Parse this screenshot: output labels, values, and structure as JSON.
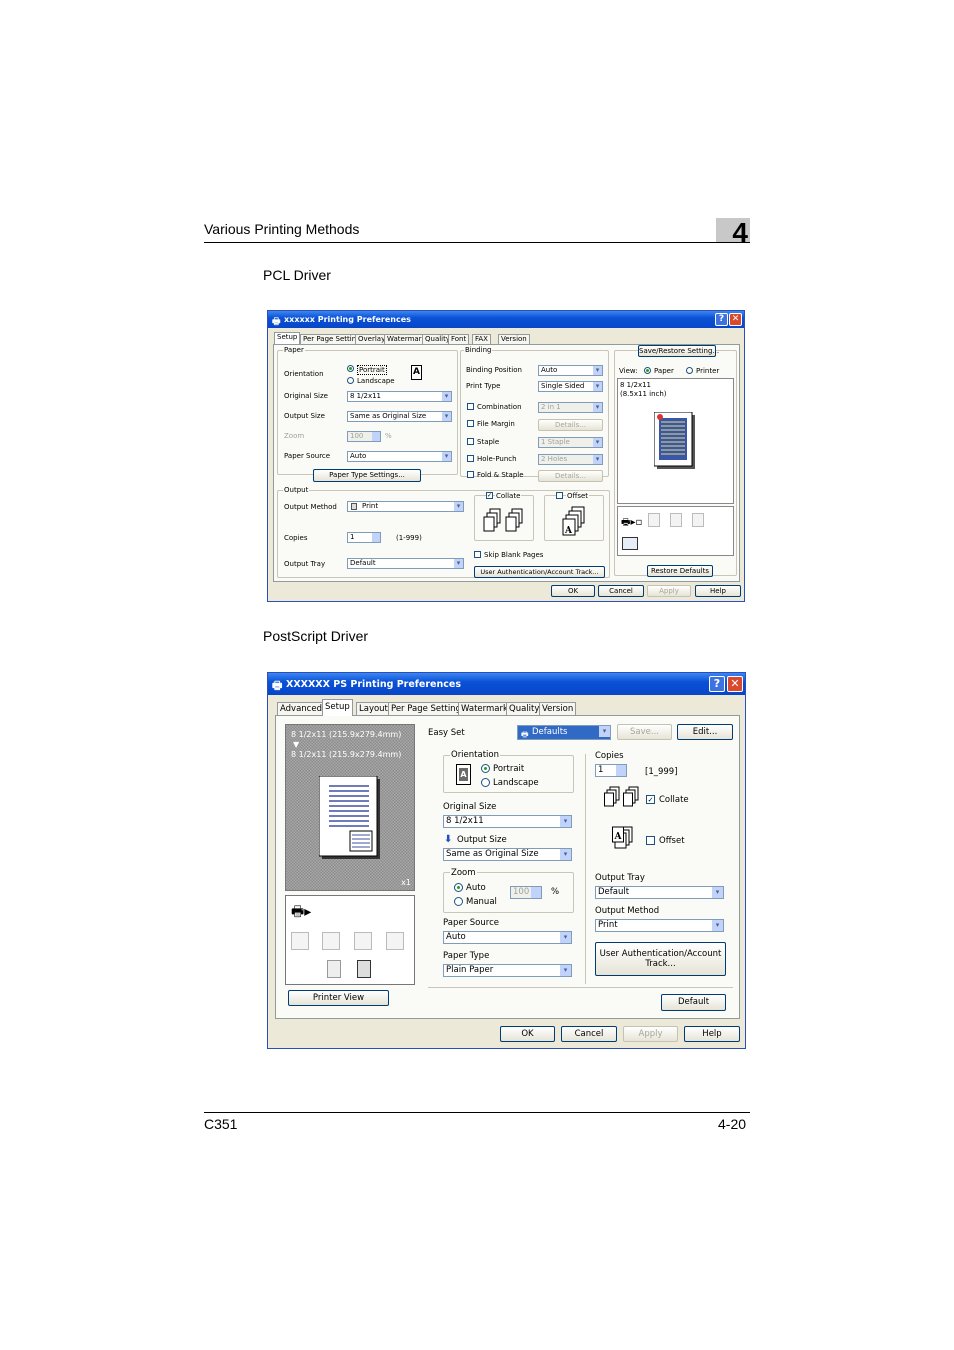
{
  "header": {
    "title": "Various Printing Methods",
    "chapter": "4"
  },
  "sections": {
    "pcl": "PCL Driver",
    "ps": "PostScript Driver"
  },
  "footer": {
    "model": "C351",
    "page": "4-20"
  },
  "pcl": {
    "title": "xxxxxx Printing Preferences",
    "tabs": [
      "Setup",
      "Per Page Setting",
      "Overlay",
      "Watermark",
      "Quality",
      "Font",
      "FAX",
      "Version"
    ],
    "paper": {
      "group": "Paper",
      "orientation_label": "Orientation",
      "portrait": "Portrait",
      "landscape": "Landscape",
      "original_size_label": "Original Size",
      "original_size": "8 1/2x11",
      "output_size_label": "Output Size",
      "output_size": "Same as Original Size",
      "zoom_label": "Zoom",
      "zoom": "100",
      "zoom_unit": "%",
      "paper_source_label": "Paper Source",
      "paper_source": "Auto",
      "paper_type_button": "Paper Type Settings..."
    },
    "binding": {
      "group": "Binding",
      "position_label": "Binding Position",
      "position": "Auto",
      "print_type_label": "Print Type",
      "print_type": "Single Sided",
      "combination": "Combination",
      "combination_value": "2 in 1",
      "details": "Details...",
      "file_margin": "File Margin",
      "staple": "Staple",
      "staple_value": "1 Staple",
      "hole_punch": "Hole-Punch",
      "hole_value": "2 Holes",
      "fold_staple": "Fold & Staple"
    },
    "right": {
      "save_restore": "Save/Restore Setting...",
      "view_label": "View:",
      "view_paper": "Paper",
      "view_printer": "Printer",
      "paper_info_1": "8 1/2x11",
      "paper_info_2": "(8.5x11 inch)",
      "restore_defaults": "Restore Defaults"
    },
    "output": {
      "group": "Output",
      "method_label": "Output Method",
      "method": "Print",
      "copies_label": "Copies",
      "copies": "1",
      "copies_range": "(1-999)",
      "tray_label": "Output Tray",
      "tray": "Default",
      "collate": "Collate",
      "offset": "Offset",
      "skip_blank": "Skip Blank Pages",
      "user_auth": "User Authentication/Account Track..."
    },
    "buttons": {
      "ok": "OK",
      "cancel": "Cancel",
      "apply": "Apply",
      "help": "Help"
    }
  },
  "ps": {
    "title": "XXXXXX PS Printing Preferences",
    "tabs": [
      "Advanced",
      "Setup",
      "Layout",
      "Per Page Setting",
      "Watermark",
      "Quality",
      "Version"
    ],
    "preview": {
      "line1": "8 1/2x11 (215.9x279.4mm)",
      "arrow": "▼",
      "line2": "8 1/2x11 (215.9x279.4mm)",
      "count": "x1",
      "printer_view": "Printer View"
    },
    "easy_set_label": "Easy Set",
    "easy_set": "Defaults",
    "save": "Save...",
    "edit": "Edit...",
    "orientation": {
      "group": "Orientation",
      "portrait": "Portrait",
      "landscape": "Landscape"
    },
    "original_size_label": "Original Size",
    "original_size": "8 1/2x11",
    "output_size_label": "Output Size",
    "output_size": "Same as Original Size",
    "zoom": {
      "group": "Zoom",
      "auto": "Auto",
      "manual": "Manual",
      "value": "100",
      "unit": "%"
    },
    "paper_source_label": "Paper Source",
    "paper_source": "Auto",
    "paper_type_label": "Paper Type",
    "paper_type": "Plain Paper",
    "copies_label": "Copies",
    "copies": "1",
    "copies_range": "[1_999]",
    "collate": "Collate",
    "offset": "Offset",
    "tray_label": "Output Tray",
    "tray": "Default",
    "method_label": "Output Method",
    "method": "Print",
    "user_auth": "User Authentication/Account Track...",
    "default": "Default",
    "buttons": {
      "ok": "OK",
      "cancel": "Cancel",
      "apply": "Apply",
      "help": "Help"
    }
  }
}
